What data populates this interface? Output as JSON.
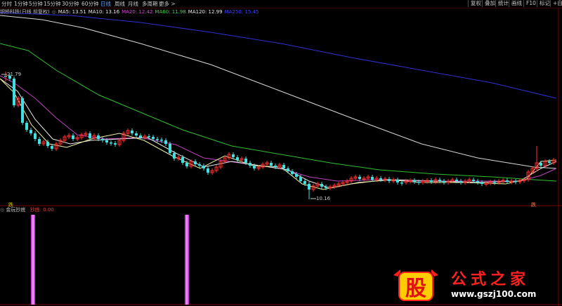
{
  "periods": [
    {
      "label": "分时",
      "active": false
    },
    {
      "label": "1分钟",
      "active": false
    },
    {
      "label": "5分钟",
      "active": false
    },
    {
      "label": "15分钟",
      "active": false
    },
    {
      "label": "30分钟",
      "active": false
    },
    {
      "label": "60分钟",
      "active": false
    },
    {
      "label": "日线",
      "active": true
    },
    {
      "label": "周线",
      "active": false
    },
    {
      "label": "月线",
      "active": false
    },
    {
      "label": "多周期",
      "active": false
    },
    {
      "label": "更多 >",
      "active": false
    }
  ],
  "right_buttons": [
    "复权",
    "叠加",
    "统计",
    "画线",
    "F10",
    "标记",
    "+自选"
  ],
  "stock_name": "钢桥科技(日线 前复权)",
  "ma": [
    {
      "label": "MA5: 13.51",
      "color": "#e8e8e8"
    },
    {
      "label": "MA10: 13.16",
      "color": "#e8e8e8"
    },
    {
      "label": "MA20: 12.42",
      "color": "#e040e0"
    },
    {
      "label": "MA60: 11.98",
      "color": "#40d040"
    },
    {
      "label": "MA120: 12.99",
      "color": "#e8e8e8"
    },
    {
      "label": "MA250: 15.45",
      "color": "#4040ff"
    }
  ],
  "high_label": "21.79",
  "low_label": "10.16",
  "left_marker": "跌",
  "right_marker": "跌",
  "indicator": {
    "name": "金玩抄底",
    "value_label": "抄底: 0.00"
  },
  "watermark": {
    "text": "公式之家",
    "url": "www.gszj100.com",
    "logo": "股"
  },
  "colors": {
    "up": "#ff3030",
    "down": "#40e0e0",
    "ma20": "#c040c0",
    "ma60": "#30c030",
    "ma250": "#3030d0",
    "ma120": "#d8d8d8",
    "signal": "#d040e0"
  }
}
